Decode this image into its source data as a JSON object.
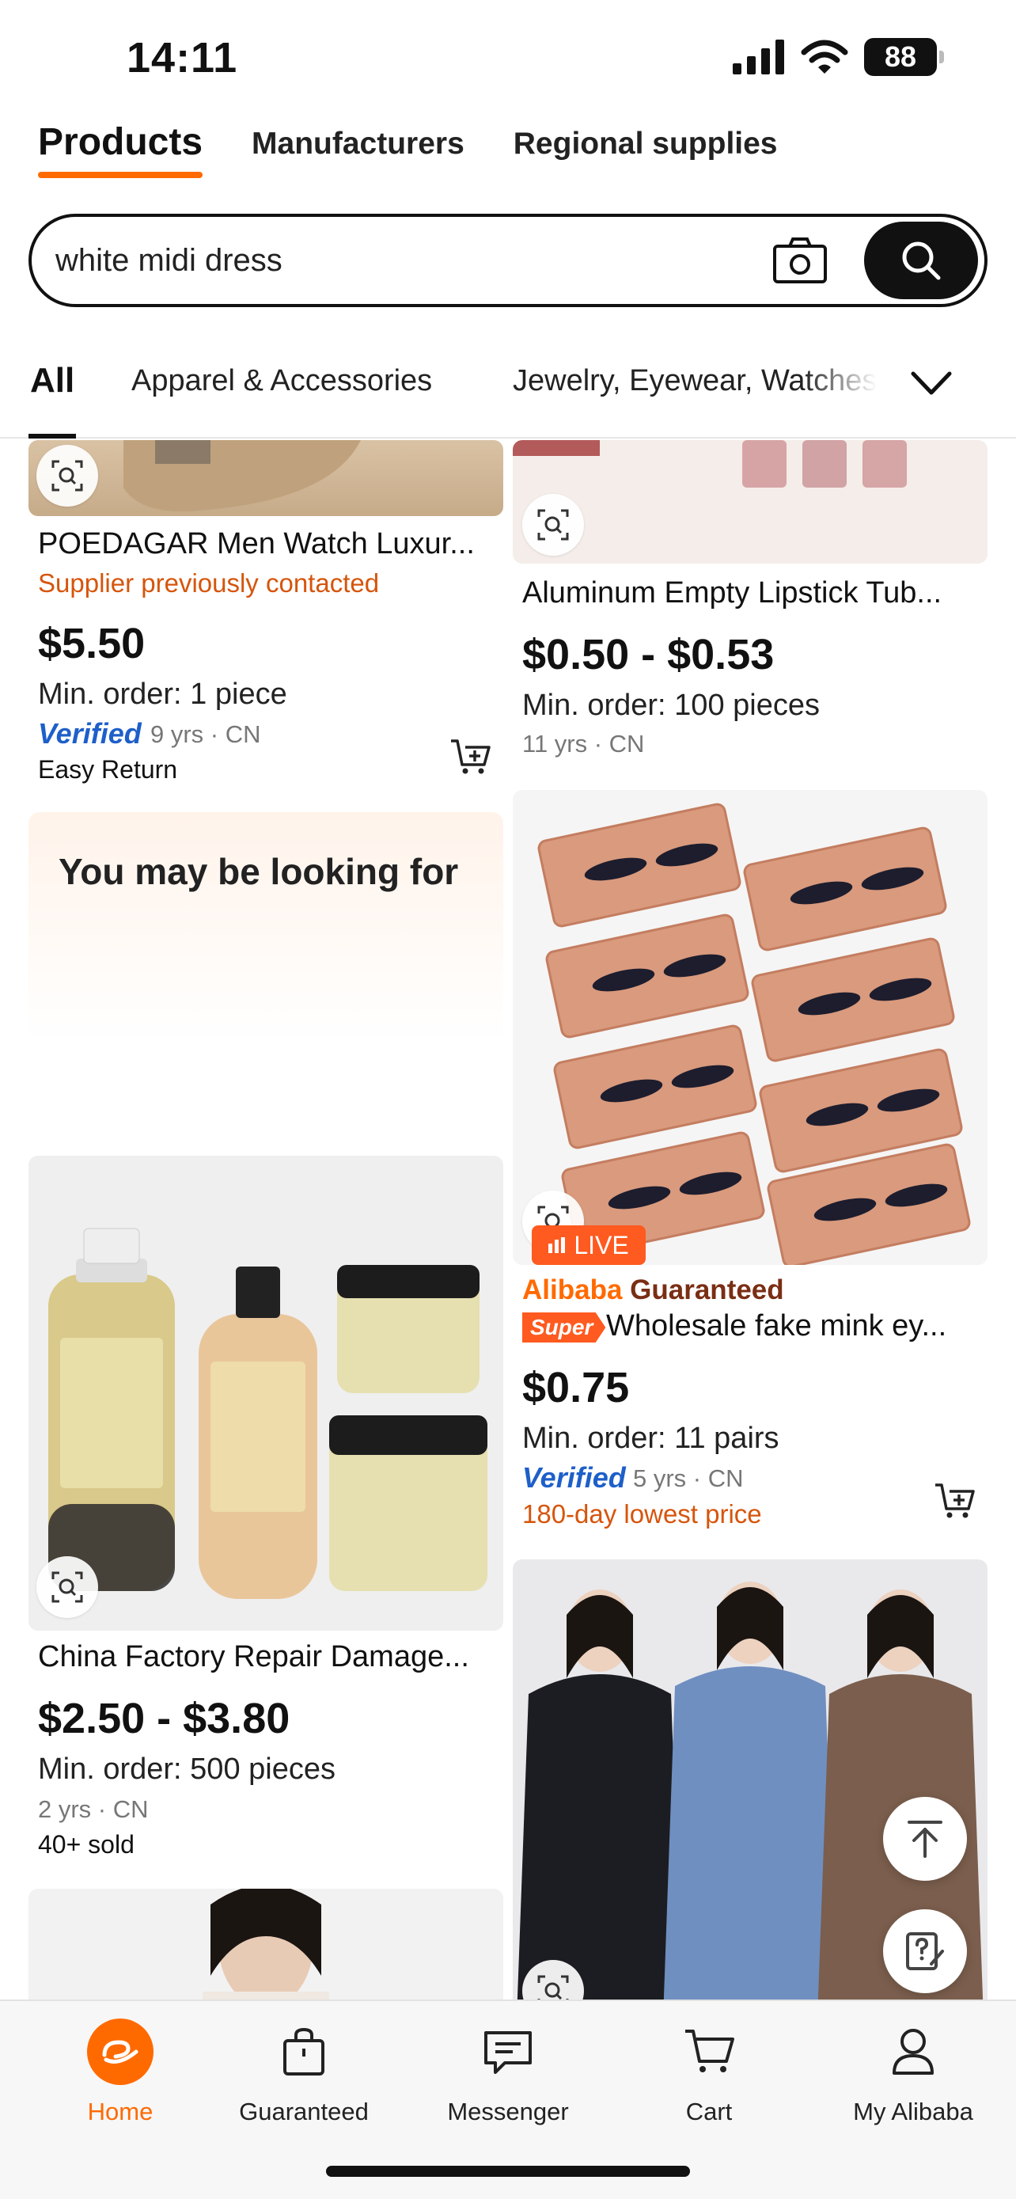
{
  "status_bar": {
    "time": "14:11",
    "battery": "88"
  },
  "top_tabs": [
    {
      "label": "Products",
      "active": true
    },
    {
      "label": "Manufacturers",
      "active": false
    },
    {
      "label": "Regional supplies",
      "active": false
    }
  ],
  "search": {
    "query": "white midi dress"
  },
  "category_tabs": [
    {
      "label": "All",
      "active": true
    },
    {
      "label": "Apparel & Accessories",
      "active": false
    },
    {
      "label": "Jewelry, Eyewear, Watches",
      "active": false
    }
  ],
  "feed": {
    "watch": {
      "title": "POEDAGAR Men Watch Luxur...",
      "note": "Supplier previously contacted",
      "price": "$5.50",
      "moq": "Min. order: 1 piece",
      "verified": "Verified",
      "meta": "9 yrs · CN",
      "badge": "Easy Return"
    },
    "lipstick": {
      "title": "Aluminum Empty Lipstick Tub...",
      "price": "$0.50 - $0.53",
      "moq": "Min. order: 100 pieces",
      "meta": "11 yrs · CN"
    },
    "may_be_looking": {
      "title": "You may be looking for"
    },
    "lashes": {
      "guarantee_part1": "Alibaba",
      "guarantee_part2": "Guaranteed",
      "super_badge": "Super",
      "title": "Wholesale fake mink ey...",
      "price": "$0.75",
      "moq": "Min. order: 11 pairs",
      "verified": "Verified",
      "meta": "5 yrs · CN",
      "note": "180-day lowest price"
    },
    "shampoo": {
      "title": "China Factory Repair Damage...",
      "price": "$2.50 - $3.80",
      "moq": "Min. order: 500 pieces",
      "meta": "2 yrs · CN",
      "sold": "40+ sold"
    },
    "coats": {
      "live_badge": "LIVE"
    }
  },
  "bottom_nav": [
    {
      "label": "Home",
      "icon": "home-logo-icon",
      "active": true
    },
    {
      "label": "Guaranteed",
      "icon": "shopping-bag-icon",
      "active": false
    },
    {
      "label": "Messenger",
      "icon": "message-icon",
      "active": false
    },
    {
      "label": "Cart",
      "icon": "cart-icon",
      "active": false
    },
    {
      "label": "My Alibaba",
      "icon": "user-icon",
      "active": false
    }
  ],
  "colors": {
    "accent": "#ff6a00",
    "verified_blue": "#1e5fc9",
    "note_orange": "#d6550c"
  }
}
